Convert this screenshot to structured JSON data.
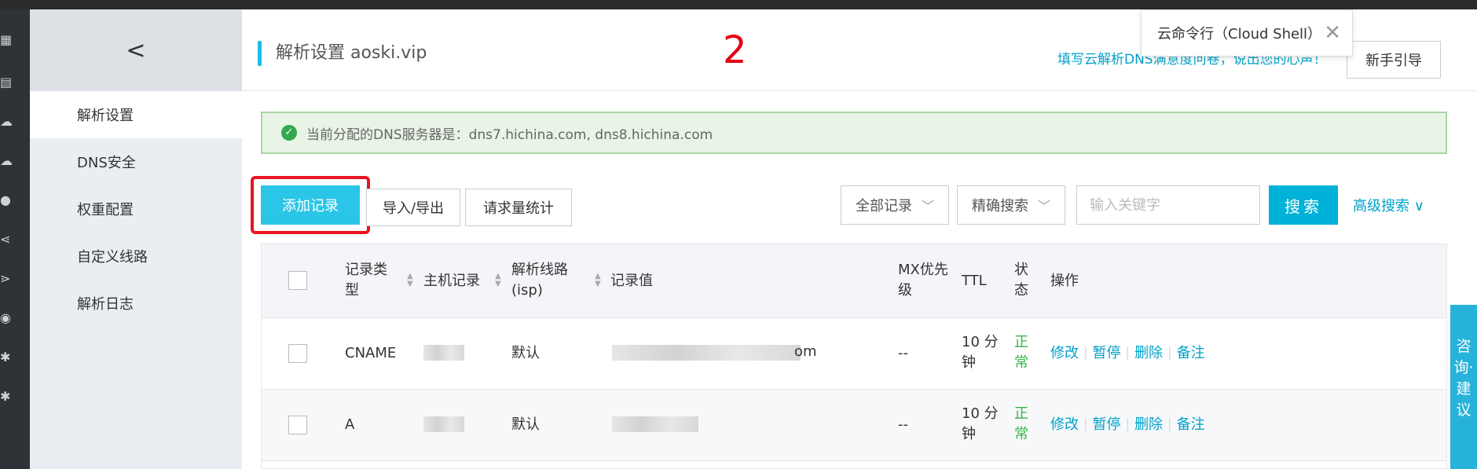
{
  "header": {
    "title": "解析设置 aoski.vip",
    "step_number": "2",
    "survey_link": "填写云解析DNS满意度问卷，说出您的心声！",
    "guide_button": "新手引导"
  },
  "cloud_shell": {
    "label": "云命令行（Cloud Shell）",
    "close": "✕"
  },
  "subnav": {
    "collapse": "<",
    "items": [
      {
        "label": "解析设置",
        "active": true
      },
      {
        "label": "DNS安全"
      },
      {
        "label": "权重配置"
      },
      {
        "label": "自定义线路"
      },
      {
        "label": "解析日志"
      }
    ]
  },
  "notice": {
    "text": "当前分配的DNS服务器是：dns7.hichina.com, dns8.hichina.com"
  },
  "toolbar": {
    "add_record": "添加记录",
    "import_export": "导入/导出",
    "request_stats": "请求量统计",
    "filter_select": "全部记录",
    "search_mode": "精确搜索",
    "search_placeholder": "输入关键字",
    "search_button": "搜索",
    "advanced_search": "高级搜索"
  },
  "table": {
    "columns": {
      "type": "记录类型",
      "host": "主机记录",
      "line": "解析线路(isp)",
      "value": "记录值",
      "mx": "MX优先级",
      "ttl": "TTL",
      "status": "状态",
      "actions": "操作"
    },
    "rows": [
      {
        "type": "CNAME",
        "line": "默认",
        "value_suffix": "om",
        "mx": "--",
        "ttl": "10 分钟",
        "status": "正常"
      },
      {
        "type": "A",
        "line": "默认",
        "value_suffix": "",
        "mx": "--",
        "ttl": "10 分钟",
        "status": "正常"
      }
    ],
    "actions": [
      "修改",
      "暂停",
      "删除",
      "备注"
    ]
  },
  "feedback": {
    "label": "咨询·建议"
  },
  "colors": {
    "accent": "#2bc6e7",
    "link": "#00a2ca",
    "status_ok": "#37b34a",
    "highlight_red": "#e8141e"
  }
}
